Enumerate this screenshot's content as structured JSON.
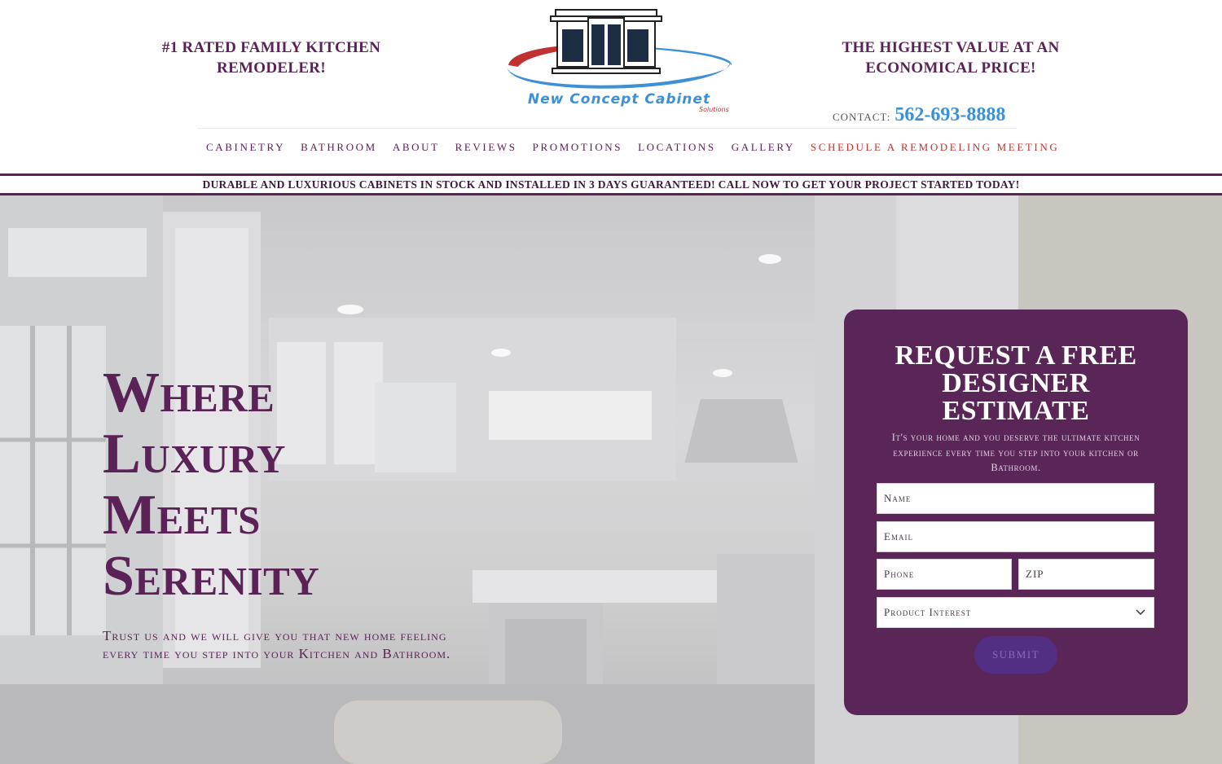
{
  "header": {
    "tagline_left_line1": "#1 Rated Family Kitchen",
    "tagline_left_line2": "Remodeler!",
    "tagline_right_line1": "The Highest Value at an",
    "tagline_right_line2": "Economical Price!",
    "logo_text": "New Concept Cabinet",
    "logo_subtext": "Solutions",
    "contact_label": "Contact:",
    "contact_phone": "562-693-8888"
  },
  "nav": {
    "items": [
      "Cabinetry",
      "Bathroom",
      "About",
      "Reviews",
      "Promotions",
      "Locations",
      "Gallery"
    ],
    "cta": "Schedule a Remodeling Meeting"
  },
  "banner": {
    "text": "Durable and luxurious cabinets in stock and installed in 3 days guaranteed! Call now to get your project started today!"
  },
  "hero": {
    "title_lines": [
      "Where",
      "Luxury",
      "Meets",
      "Serenity"
    ],
    "subtitle_line1": "Trust us and we will give you that new home feeling",
    "subtitle_line2": "every time you step into your Kitchen and Bathroom."
  },
  "form": {
    "title_line1": "Request a Free",
    "title_line2": "Designer",
    "title_line3": "Estimate",
    "description": "It's your home and you deserve the ultimate kitchen experience every time you step into your kitchen or Bathroom.",
    "name_placeholder": "Name",
    "email_placeholder": "Email",
    "phone_placeholder": "Phone",
    "zip_placeholder": "ZIP",
    "product_placeholder": "Product Interest",
    "submit_label": "Submit"
  },
  "colors": {
    "brand_purple": "#5a2257",
    "accent_red": "#c0322f",
    "accent_blue": "#3d8fd6",
    "card_bg": "#5a2657"
  }
}
